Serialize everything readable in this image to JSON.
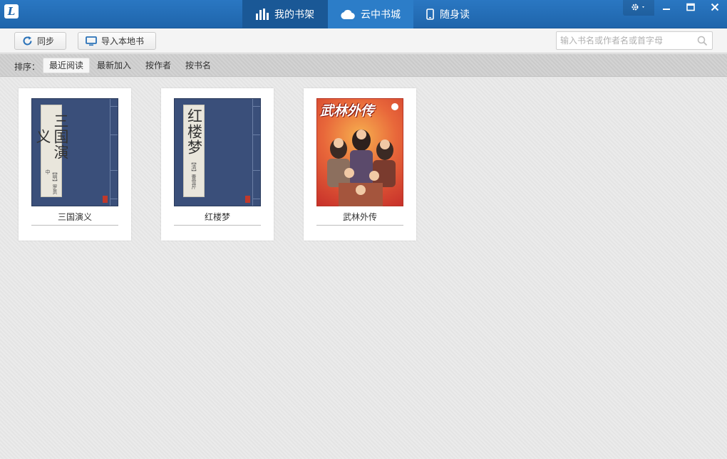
{
  "app": {
    "logo_text": "L",
    "nav": [
      {
        "label": "我的书架",
        "icon": "bar-chart-icon",
        "active": true
      },
      {
        "label": "云中书城",
        "icon": "cloud-icon",
        "active": false
      },
      {
        "label": "随身读",
        "icon": "phone-icon",
        "active": false
      }
    ],
    "window_controls": [
      "settings-gear-icon",
      "minimize-icon",
      "maximize-icon",
      "close-icon"
    ]
  },
  "toolbar": {
    "sync_label": "同步",
    "import_label": "导入本地书",
    "search_placeholder": "输入书名或作者名或首字母"
  },
  "sortbar": {
    "label": "排序：",
    "options": [
      {
        "label": "最近阅读",
        "active": true
      },
      {
        "label": "最新加入",
        "active": false
      },
      {
        "label": "按作者",
        "active": false
      },
      {
        "label": "按书名",
        "active": false
      }
    ]
  },
  "books": [
    {
      "title": "三国演义",
      "cover_title": "三国演义",
      "cover_author": "【明】罗贯中",
      "cover_style": "classic"
    },
    {
      "title": "红楼梦",
      "cover_title": "红楼梦",
      "cover_author": "【清】曹雪芹",
      "cover_style": "classic"
    },
    {
      "title": "武林外传",
      "cover_title": "武林外传",
      "cover_style": "poster"
    }
  ],
  "colors": {
    "titlebar": "#1f65ab",
    "active_tab": "#1a5896",
    "classic_cover": "#3a4f7a"
  }
}
